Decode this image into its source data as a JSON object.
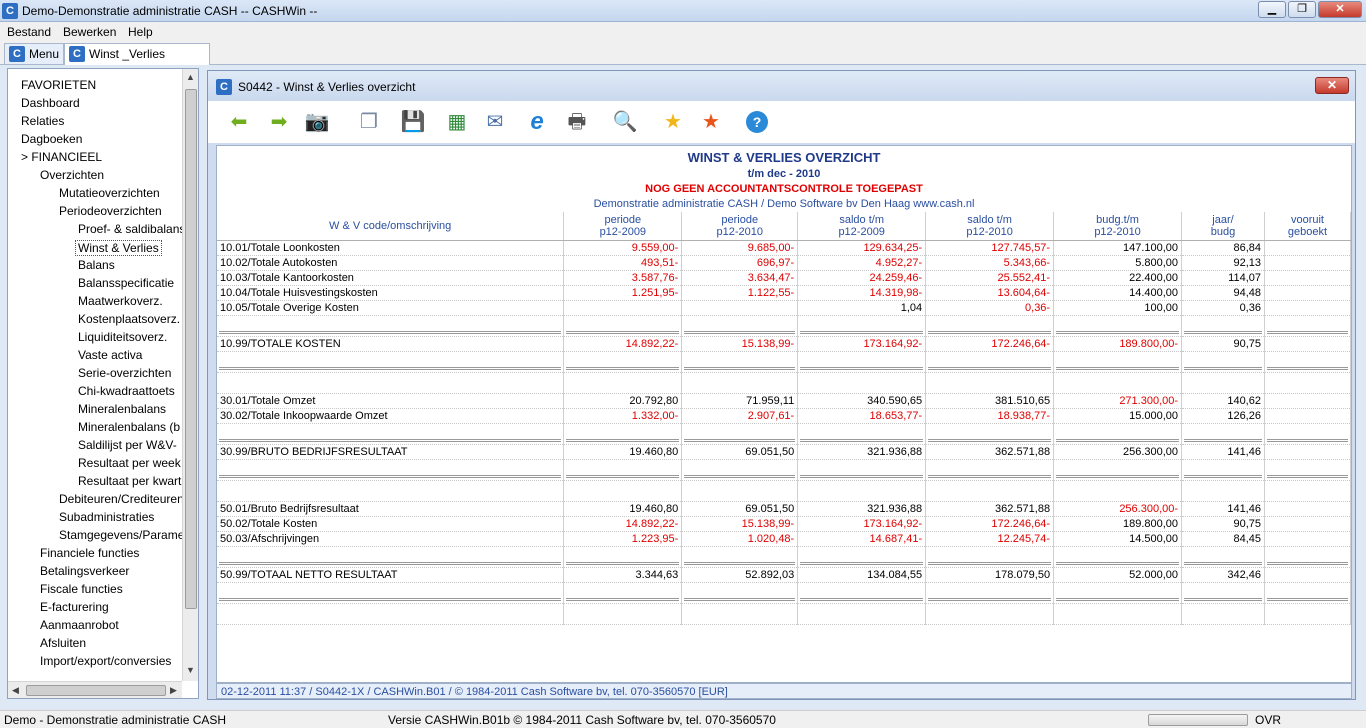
{
  "window": {
    "title": "Demo-Demonstratie administratie CASH  -- CASHWin --",
    "app_icon": "C"
  },
  "menu": [
    "Bestand",
    "Bewerken",
    "Help"
  ],
  "tabs": [
    {
      "label": "Menu"
    },
    {
      "label": "Winst _Verlies overzicht"
    }
  ],
  "sidebar": {
    "items": [
      {
        "label": "FAVORIETEN",
        "level": 0
      },
      {
        "label": "Dashboard",
        "level": 0
      },
      {
        "label": "Relaties",
        "level": 0
      },
      {
        "label": "Dagboeken",
        "level": 0
      },
      {
        "label": "> FINANCIEEL",
        "level": 0
      },
      {
        "label": "Overzichten",
        "level": 1
      },
      {
        "label": "Mutatieoverzichten",
        "level": 2
      },
      {
        "label": "Periodeoverzichten",
        "level": 2
      },
      {
        "label": "Proef- & saldibalans",
        "level": 3
      },
      {
        "label": "Winst & Verlies",
        "level": 3,
        "selected": true
      },
      {
        "label": "Balans",
        "level": 3
      },
      {
        "label": "Balansspecificatie",
        "level": 3
      },
      {
        "label": "Maatwerkoverz.",
        "level": 3
      },
      {
        "label": "Kostenplaatsoverz.",
        "level": 3
      },
      {
        "label": "Liquiditeitsoverz.",
        "level": 3
      },
      {
        "label": "Vaste activa",
        "level": 3
      },
      {
        "label": "Serie-overzichten",
        "level": 3
      },
      {
        "label": "Chi-kwadraattoets",
        "level": 3
      },
      {
        "label": "Mineralenbalans",
        "level": 3
      },
      {
        "label": "Mineralenbalans (b",
        "level": 3
      },
      {
        "label": "Saldilijst per W&V-",
        "level": 3
      },
      {
        "label": "Resultaat per week",
        "level": 3
      },
      {
        "label": "Resultaat per kwart",
        "level": 3
      },
      {
        "label": "Debiteuren/Crediteuren",
        "level": 2
      },
      {
        "label": "Subadministraties",
        "level": 2
      },
      {
        "label": "Stamgegevens/Parame",
        "level": 2
      },
      {
        "label": "Financiele functies",
        "level": 1
      },
      {
        "label": "Betalingsverkeer",
        "level": 1
      },
      {
        "label": "Fiscale functies",
        "level": 1
      },
      {
        "label": "E-facturering",
        "level": 1
      },
      {
        "label": "Aanmaanrobot",
        "level": 1
      },
      {
        "label": "Afsluiten",
        "level": 1
      },
      {
        "label": "Import/export/conversies",
        "level": 1
      }
    ]
  },
  "child_window": {
    "title": "S0442 - Winst & Verlies overzicht",
    "close_label": "✕"
  },
  "toolbar": [
    {
      "name": "back-arrow-icon",
      "glyph": "⬅",
      "color": "#6fae1f"
    },
    {
      "name": "forward-arrow-icon",
      "glyph": "➡",
      "color": "#6fae1f"
    },
    {
      "name": "camera-icon",
      "glyph": "📷",
      "color": "#333333"
    },
    {
      "name": "copy-icon",
      "glyph": "❐",
      "color": "#7a8aa0"
    },
    {
      "name": "save-disk-icon",
      "glyph": "💾",
      "color": "#1f2f5a"
    },
    {
      "name": "excel-icon",
      "glyph": "▦",
      "color": "#2f8a3a"
    },
    {
      "name": "email-icon",
      "glyph": "✉",
      "color": "#4a6fa8"
    },
    {
      "name": "internet-explorer-icon",
      "glyph": "e",
      "color": "#1e7fd8"
    },
    {
      "name": "printer-icon",
      "glyph": "🖶",
      "color": "#555555"
    },
    {
      "name": "search-icon",
      "glyph": "🔍",
      "color": "#2a4fa0"
    },
    {
      "name": "star-favorite-icon",
      "glyph": "★",
      "color": "#f2b51a"
    },
    {
      "name": "star-remove-icon",
      "glyph": "★",
      "color": "#e8551a"
    },
    {
      "name": "help-icon",
      "glyph": "?",
      "color": "#2a8ad8"
    }
  ],
  "report": {
    "title": "WINST & VERLIES OVERZICHT",
    "period": "t/m dec - 2010",
    "warning": "NOG GEEN ACCOUNTANTSCONTROLE TOEGEPAST",
    "company": "Demonstratie administratie CASH / Demo Software bv Den Haag www.cash.nl",
    "columns": [
      {
        "line1": "W & V code/omschrijving",
        "line2": ""
      },
      {
        "line1": "periode",
        "line2": "p12-2009"
      },
      {
        "line1": "periode",
        "line2": "p12-2010"
      },
      {
        "line1": "saldo t/m",
        "line2": "p12-2009"
      },
      {
        "line1": "saldo t/m",
        "line2": "p12-2010"
      },
      {
        "line1": "budg.t/m",
        "line2": "p12-2010"
      },
      {
        "line1": "jaar/",
        "line2": "budg"
      },
      {
        "line1": "vooruit",
        "line2": "geboekt"
      }
    ],
    "rows": [
      {
        "type": "data",
        "cells": [
          "10.01/Totale Loonkosten",
          "9.559,00-",
          "9.685,00-",
          "129.634,25-",
          "127.745,57-",
          "147.100,00",
          "86,84",
          ""
        ]
      },
      {
        "type": "data",
        "cells": [
          "10.02/Totale Autokosten",
          "493,51-",
          "696,97-",
          "4.952,27-",
          "5.343,66-",
          "5.800,00",
          "92,13",
          ""
        ]
      },
      {
        "type": "data",
        "cells": [
          "10.03/Totale Kantoorkosten",
          "3.587,76-",
          "3.634,47-",
          "24.259,46-",
          "25.552,41-",
          "22.400,00",
          "114,07",
          ""
        ]
      },
      {
        "type": "data",
        "cells": [
          "10.04/Totale Huisvestingskosten",
          "1.251,95-",
          "1.122,55-",
          "14.319,98-",
          "13.604,64-",
          "14.400,00",
          "94,48",
          ""
        ]
      },
      {
        "type": "data",
        "cells": [
          "10.05/Totale Overige Kosten",
          "",
          "",
          "1,04",
          "0,36-",
          "100,00",
          "0,36",
          ""
        ]
      },
      {
        "type": "sep"
      },
      {
        "type": "data",
        "cells": [
          "10.99/TOTALE KOSTEN",
          "14.892,22-",
          "15.138,99-",
          "173.164,92-",
          "172.246,64-",
          "189.800,00-",
          "90,75",
          ""
        ]
      },
      {
        "type": "sep"
      },
      {
        "type": "spacer"
      },
      {
        "type": "data",
        "cells": [
          "30.01/Totale Omzet",
          "20.792,80",
          "71.959,11",
          "340.590,65",
          "381.510,65",
          "271.300,00-",
          "140,62",
          ""
        ]
      },
      {
        "type": "data",
        "cells": [
          "30.02/Totale Inkoopwaarde Omzet",
          "1.332,00-",
          "2.907,61-",
          "18.653,77-",
          "18.938,77-",
          "15.000,00",
          "126,26",
          ""
        ]
      },
      {
        "type": "sep"
      },
      {
        "type": "data",
        "cells": [
          "30.99/BRUTO BEDRIJFSRESULTAAT",
          "19.460,80",
          "69.051,50",
          "321.936,88",
          "362.571,88",
          "256.300,00",
          "141,46",
          ""
        ]
      },
      {
        "type": "sep"
      },
      {
        "type": "spacer"
      },
      {
        "type": "data",
        "cells": [
          "50.01/Bruto Bedrijfsresultaat",
          "19.460,80",
          "69.051,50",
          "321.936,88",
          "362.571,88",
          "256.300,00-",
          "141,46",
          ""
        ]
      },
      {
        "type": "data",
        "cells": [
          "50.02/Totale Kosten",
          "14.892,22-",
          "15.138,99-",
          "173.164,92-",
          "172.246,64-",
          "189.800,00",
          "90,75",
          ""
        ]
      },
      {
        "type": "data",
        "cells": [
          "50.03/Afschrijvingen",
          "1.223,95-",
          "1.020,48-",
          "14.687,41-",
          "12.245,74-",
          "14.500,00",
          "84,45",
          ""
        ]
      },
      {
        "type": "sep"
      },
      {
        "type": "data",
        "cells": [
          "50.99/TOTAAL NETTO RESULTAAT",
          "3.344,63",
          "52.892,03",
          "134.084,55",
          "178.079,50",
          "52.000,00",
          "342,46",
          ""
        ]
      },
      {
        "type": "sep"
      },
      {
        "type": "spacer"
      }
    ],
    "footer": "02-12-2011 11:37 / S0442-1X / CASHWin.B01 / © 1984-2011 Cash Software bv, tel. 070-3560570 [EUR]"
  },
  "statusbar": {
    "left": "Demo - Demonstratie administratie CASH",
    "center": "Versie CASHWin.B01b © 1984-2011 Cash Software bv, tel. 070-3560570",
    "right": "OVR"
  },
  "colors": {
    "negative": "#e00000",
    "header_blue": "#2a4fa0",
    "warning_red": "#e00000"
  }
}
